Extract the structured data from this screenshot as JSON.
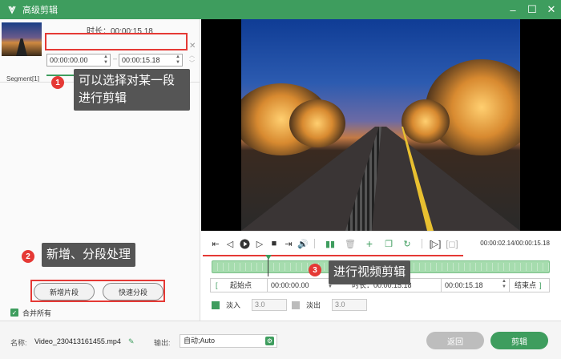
{
  "window": {
    "title": "高级剪辑"
  },
  "segment": {
    "duration_label": "时长：00:00:15.18",
    "start_time": "00:00:00.00",
    "end_time": "00:00:15.18",
    "dash": "–",
    "label": "Segment[1]"
  },
  "callouts": [
    {
      "number": "1",
      "text": "可以选择对某一段进行剪辑"
    },
    {
      "number": "2",
      "text": "新增、分段处理"
    },
    {
      "number": "3",
      "text": "进行视频剪辑"
    }
  ],
  "left_buttons": {
    "add_segment": "新增片段",
    "quick_split": "快速分段"
  },
  "merge_all": {
    "label": "合并所有",
    "checked": true
  },
  "player": {
    "time_readout": "00:00:02.14/00:00:15.18",
    "controls": [
      "mark-in-icon",
      "prev-frame-icon",
      "play-icon",
      "next-frame-icon",
      "stop-icon",
      "mark-out-icon",
      "volume-icon",
      "split-icon",
      "delete-icon",
      "add-icon",
      "copy-icon",
      "reset-icon",
      "preview-icon",
      "crop-icon"
    ]
  },
  "timeline": {
    "playhead_fraction": 0.165
  },
  "range": {
    "start_bracket": "[",
    "start_label": "起始点",
    "start_value": "00:00:00.00",
    "duration_label": "时长：00:00:15.18",
    "end_value": "00:00:15.18",
    "end_label": "结束点",
    "end_bracket": "]"
  },
  "fade": {
    "in_label": "淡入",
    "in_value": "3.0",
    "in_checked": true,
    "out_label": "淡出",
    "out_value": "3.0",
    "out_checked": false
  },
  "bottom": {
    "name_label": "名称:",
    "file_name": "Video_230413161455.mp4",
    "output_label": "输出:",
    "output_value": "自动;Auto",
    "back_button": "返回",
    "cut_button": "剪辑"
  },
  "colors": {
    "accent": "#3e9d5e",
    "highlight": "#e53935"
  }
}
